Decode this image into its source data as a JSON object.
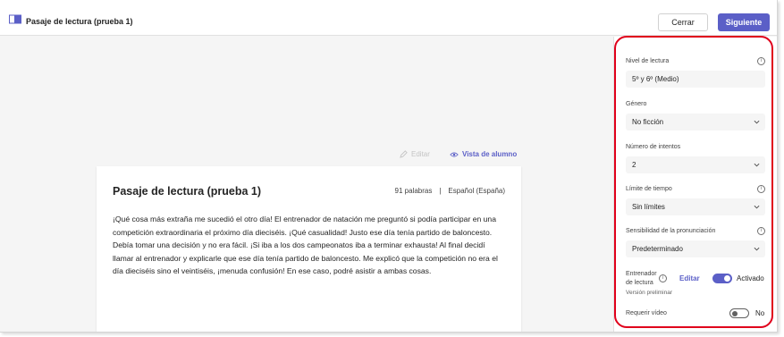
{
  "header": {
    "title": "Pasaje de lectura (prueba 1)",
    "close_label": "Cerrar",
    "next_label": "Siguiente",
    "icon": "reading-passage-icon"
  },
  "toolbar": {
    "edit_label": "Editar",
    "student_view_label": "Vista de alumno"
  },
  "passage": {
    "title": "Pasaje de lectura (prueba 1)",
    "word_count": "91 palabras",
    "separator": "|",
    "language": "Español (España)",
    "body": "¡Qué cosa más extraña me sucedió el otro día! El entrenador de natación me preguntó si podía participar en una competición extraordinaria el próximo día dieciséis. ¡Qué casualidad! Justo ese día tenía partido de baloncesto. Debía tomar una decisión y no era fácil. ¡Si iba a los dos campeonatos iba a terminar exhausta! Al final decidí llamar al entrenador y explicarle que ese día tenía partido de baloncesto. Me explicó que la competición no era el día dieciséis sino el veintiséis, ¡menuda confusión! En ese caso, podré asistir a ambas cosas."
  },
  "settings": {
    "reading_level": {
      "label": "Nivel de lectura",
      "value": "5º y 6º (Medio)"
    },
    "genre": {
      "label": "Género",
      "value": "No ficción"
    },
    "attempts": {
      "label": "Número de intentos",
      "value": "2"
    },
    "time_limit": {
      "label": "Límite de tiempo",
      "value": "Sin límites"
    },
    "pronunciation": {
      "label": "Sensibilidad de la pronunciación",
      "value": "Predeterminado"
    },
    "coach": {
      "label_line1": "Entrenador",
      "label_line2": "de lectura",
      "edit_label": "Editar",
      "state_label": "Activado",
      "enabled": true,
      "preview_note": "Versión preliminar"
    },
    "video": {
      "label": "Requerir vídeo",
      "state_label": "No",
      "enabled": false
    }
  },
  "colors": {
    "accent": "#5b5fc7",
    "highlight": "#e0001b"
  }
}
